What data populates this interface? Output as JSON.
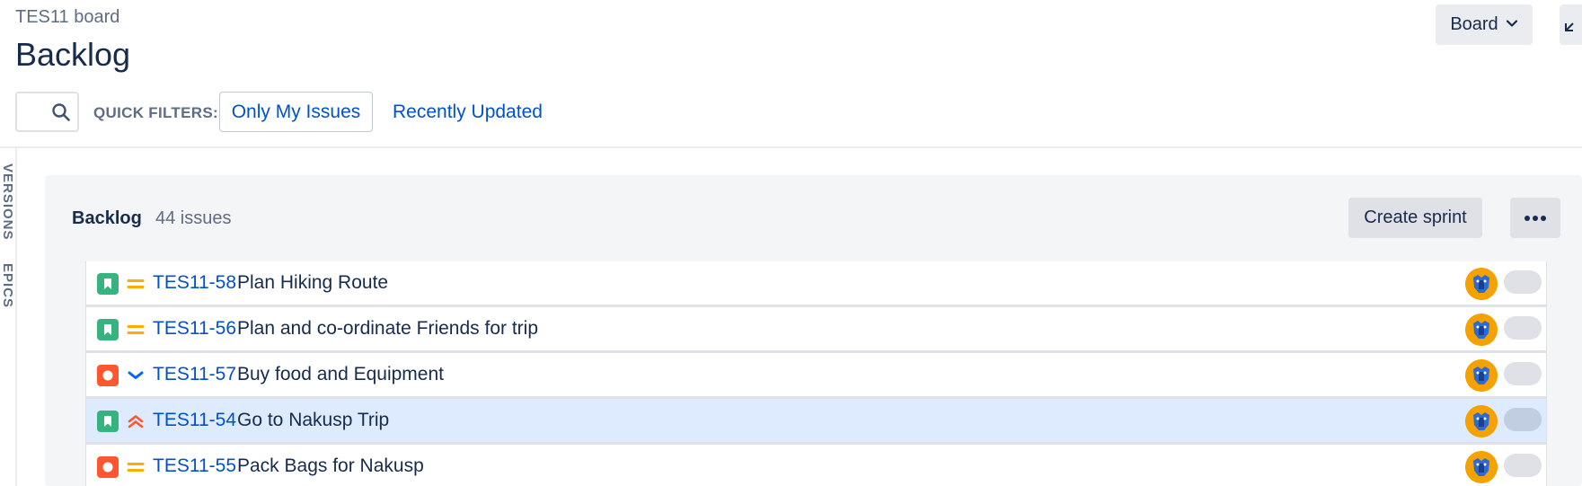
{
  "header": {
    "board_name": "TES11 board",
    "page_title": "Backlog",
    "board_button_label": "Board"
  },
  "filters": {
    "quick_filters_label": "QUICK FILTERS:",
    "only_my_issues": "Only My Issues",
    "recently_updated": "Recently Updated"
  },
  "side_tabs": {
    "versions": "VERSIONS",
    "epics": "EPICS"
  },
  "backlog": {
    "title": "Backlog",
    "issue_count": "44 issues",
    "create_sprint_label": "Create sprint",
    "more_icon": "more-horizontal-icon"
  },
  "issues": [
    {
      "key": "TES11-58",
      "summary": "Plan Hiking Route",
      "type": "story",
      "priority": "medium",
      "selected": false
    },
    {
      "key": "TES11-56",
      "summary": "Plan and co-ordinate Friends for trip",
      "type": "story",
      "priority": "medium",
      "selected": false
    },
    {
      "key": "TES11-57",
      "summary": "Buy food and Equipment",
      "type": "bug",
      "priority": "low",
      "selected": false
    },
    {
      "key": "TES11-54",
      "summary": "Go to Nakusp Trip",
      "type": "story",
      "priority": "highest",
      "selected": true
    },
    {
      "key": "TES11-55",
      "summary": "Pack Bags for Nakusp",
      "type": "bug",
      "priority": "medium",
      "selected": false
    }
  ],
  "colors": {
    "story": "#36b37e",
    "bug": "#ff5630",
    "priority_medium": "#ffab00",
    "priority_low": "#0065ff",
    "priority_high": "#ff5630",
    "link": "#0052cc",
    "selected_row": "#deebff"
  }
}
